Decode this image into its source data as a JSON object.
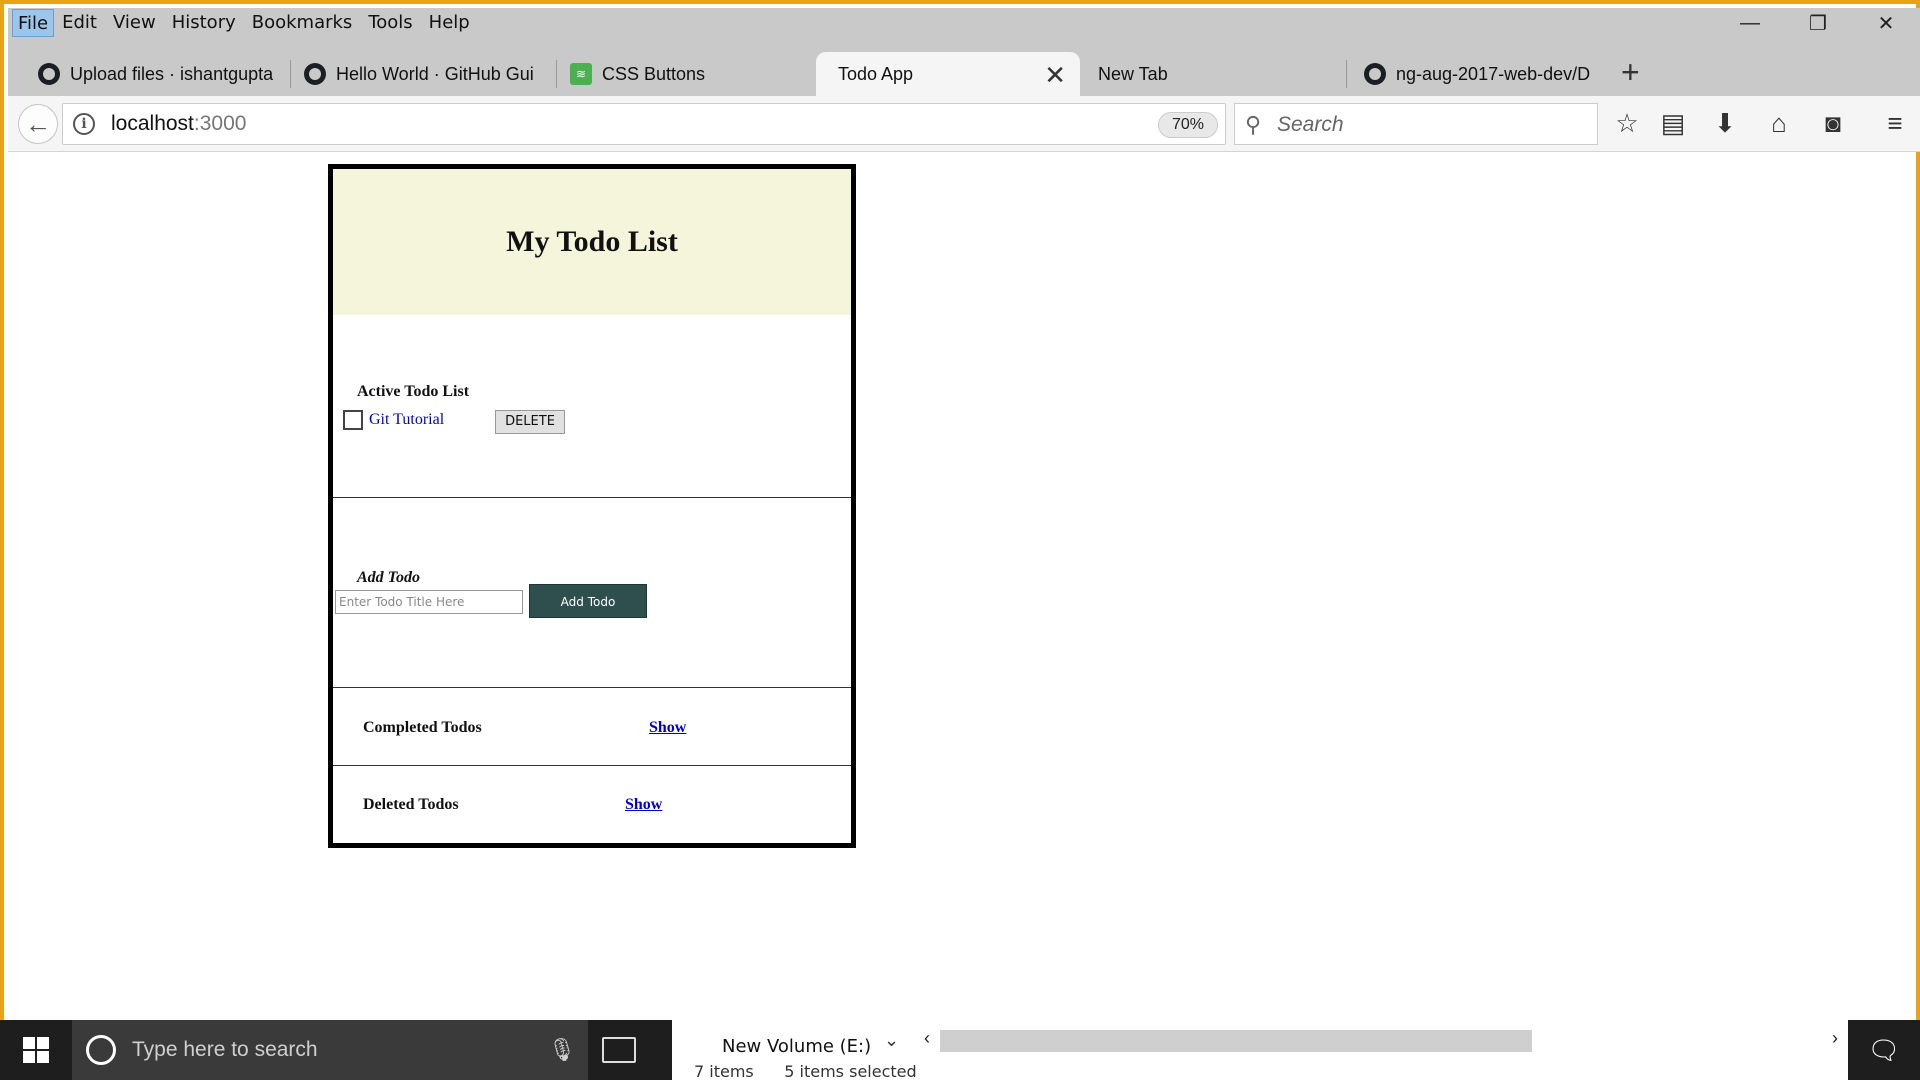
{
  "menu": {
    "items": [
      "File",
      "Edit",
      "View",
      "History",
      "Bookmarks",
      "Tools",
      "Help"
    ]
  },
  "window_controls": {
    "minimize": "—",
    "restore": "❐",
    "close": "✕"
  },
  "tabs": [
    {
      "label": "Upload files · ishantgupta",
      "icon": "github-icon"
    },
    {
      "label": "Hello World · GitHub Gui",
      "icon": "github-icon"
    },
    {
      "label": "CSS Buttons",
      "icon": "css-buttons-icon"
    },
    {
      "label": "Todo App",
      "icon": "none",
      "active": true
    },
    {
      "label": "New Tab",
      "icon": "none"
    },
    {
      "label": "ng-aug-2017-web-dev/D",
      "icon": "github-icon"
    }
  ],
  "navbar": {
    "url_host": "localhost",
    "url_port": ":3000",
    "zoom": "70%",
    "search_placeholder": "Search"
  },
  "page": {
    "header_title": "My Todo List",
    "active_section_title": "Active Todo List",
    "active_todos": [
      {
        "title": "Git Tutorial",
        "checked": false,
        "delete_label": "DELETE"
      }
    ],
    "add_section_title": "Add Todo",
    "add_input_placeholder": "Enter Todo Title Here",
    "add_button_label": "Add Todo",
    "completed_label": "Completed Todos",
    "completed_show": "Show",
    "deleted_label": "Deleted Todos",
    "deleted_show": "Show"
  },
  "taskbar": {
    "search_placeholder": "Type here to search",
    "explorer_drive": "New Volume (E:)",
    "explorer_items": "7 items",
    "explorer_selected": "5 items selected"
  },
  "colors": {
    "window_border": "#e8a317",
    "header_bg": "#f5f5dc",
    "add_button_bg": "#2f4f4f",
    "link": "#0000cc"
  }
}
